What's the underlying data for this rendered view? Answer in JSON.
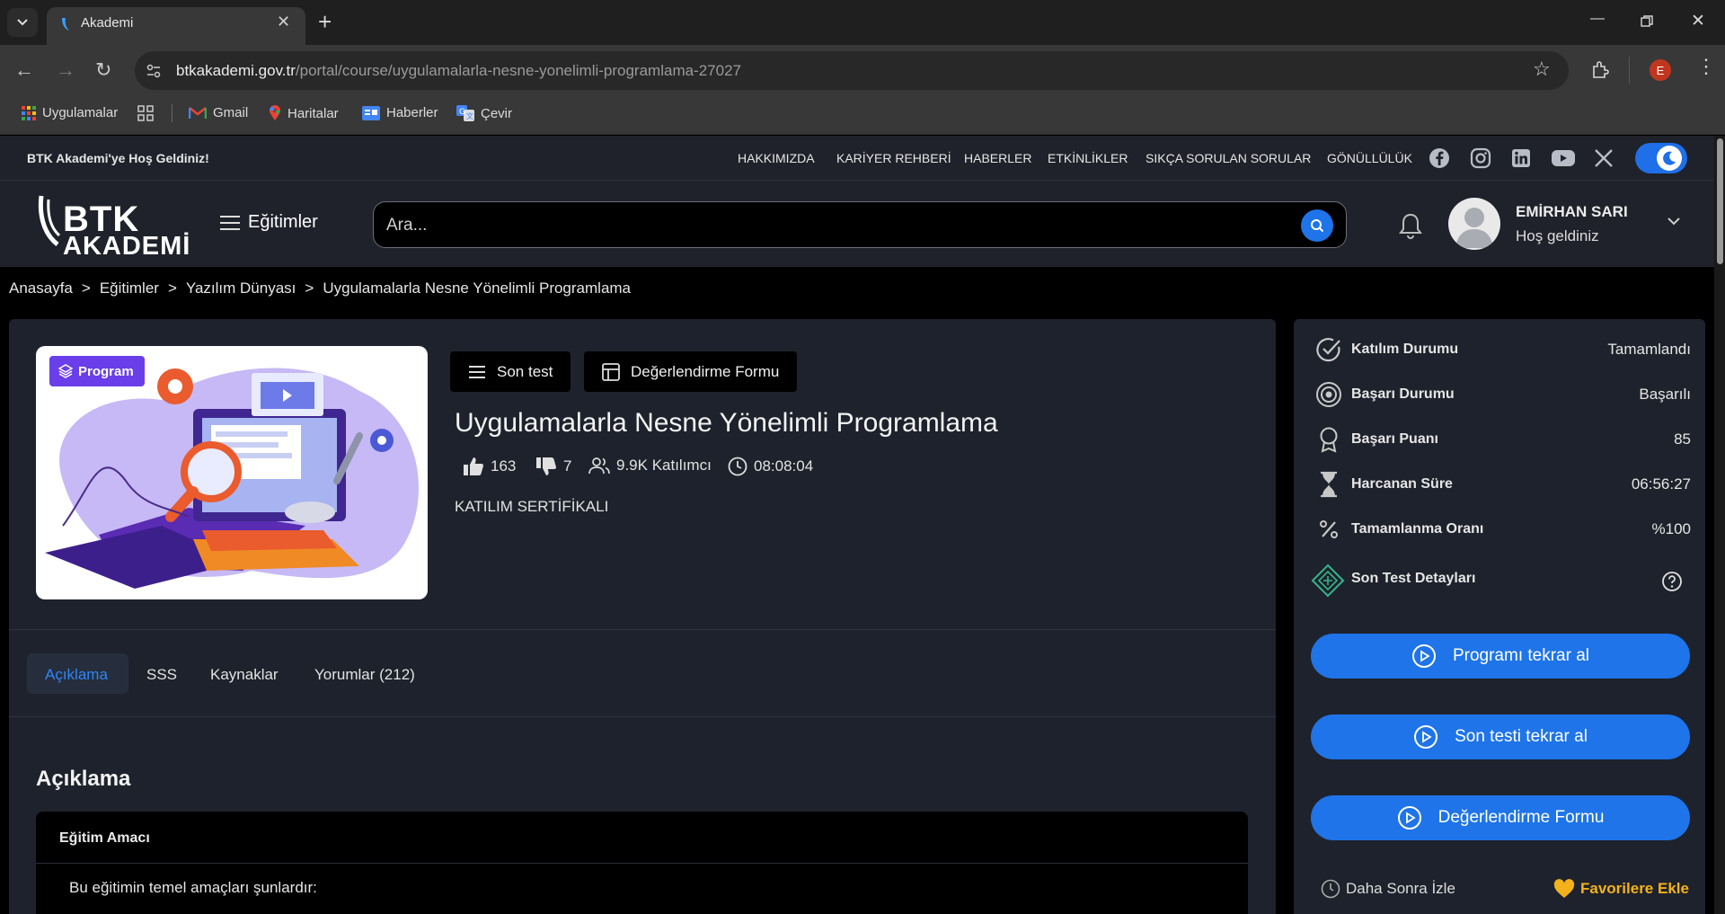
{
  "browser": {
    "tab_title": "Akademi",
    "url_host": "btkakademi.gov.tr",
    "url_path": "/portal/course/uygulamalarla-nesne-yonelimli-programlama-27027",
    "profile_initial": "E",
    "bookmarks": [
      {
        "label": "Uygulamalar",
        "icon": "apps-grid-icon"
      },
      {
        "label": "Gmail",
        "icon": "gmail-icon"
      },
      {
        "label": "Haritalar",
        "icon": "maps-icon"
      },
      {
        "label": "Haberler",
        "icon": "news-icon"
      },
      {
        "label": "Çevir",
        "icon": "translate-icon"
      }
    ]
  },
  "topbar": {
    "welcome": "BTK Akademi'ye Hoş Geldiniz!",
    "links": [
      "HAKKIMIZDA",
      "KARİYER REHBERİ",
      "HABERLER",
      "ETKİNLİKLER",
      "SIKÇA SORULAN SORULAR",
      "GÖNÜLLÜLÜK"
    ],
    "social": [
      "facebook-icon",
      "instagram-icon",
      "linkedin-icon",
      "youtube-icon",
      "x-icon"
    ]
  },
  "header": {
    "logo_line1": "BTK",
    "logo_line2": "AKADEMİ",
    "menu_label": "Eğitimler",
    "search_placeholder": "Ara...",
    "user_name": "EMİRHAN SARI",
    "user_greeting": "Hoş geldiniz"
  },
  "breadcrumb": [
    "Anasayfa",
    "Eğitimler",
    "Yazılım Dünyası",
    "Uygulamalarla Nesne Yönelimli Programlama"
  ],
  "breadcrumb_sep": ">",
  "course": {
    "badge": "Program",
    "last_test_button": "Son test",
    "evaluation_button": "Değerlendirme Formu",
    "title": "Uygulamalarla Nesne Yönelimli Programlama",
    "likes": "163",
    "dislikes": "7",
    "participants": "9.9K Katılımcı",
    "duration": "08:08:04",
    "certificate": "KATILIM SERTİFİKALI"
  },
  "tabs": [
    "Açıklama",
    "SSS",
    "Kaynaklar",
    "Yorumlar (212)"
  ],
  "description": {
    "title": "Açıklama",
    "box_title": "Eğitim Amacı",
    "intro": "Bu eğitimin temel amaçları şunlardır:"
  },
  "sidebar": {
    "rows": [
      {
        "label": "Katılım Durumu",
        "value": "Tamamlandı",
        "icon": "check-circle-icon"
      },
      {
        "label": "Başarı Durumu",
        "value": "Başarılı",
        "icon": "target-icon"
      },
      {
        "label": "Başarı Puanı",
        "value": "85",
        "icon": "award-icon"
      },
      {
        "label": "Harcanan Süre",
        "value": "06:56:27",
        "icon": "hourglass-icon"
      },
      {
        "label": "Tamamlanma Oranı",
        "value": "%100",
        "icon": "percent-icon"
      }
    ],
    "test_details": "Son Test Detayları",
    "buttons": [
      "Programı tekrar al",
      "Son testi tekrar al",
      "Değerlendirme Formu"
    ],
    "watch_later": "Daha Sonra İzle",
    "favorites": "Favorilere Ekle"
  },
  "colors": {
    "accent_blue": "#1e74e8",
    "badge_purple": "#6a3ee8",
    "favorite_gold": "#f3b21c",
    "card_bg": "#1e222c"
  }
}
